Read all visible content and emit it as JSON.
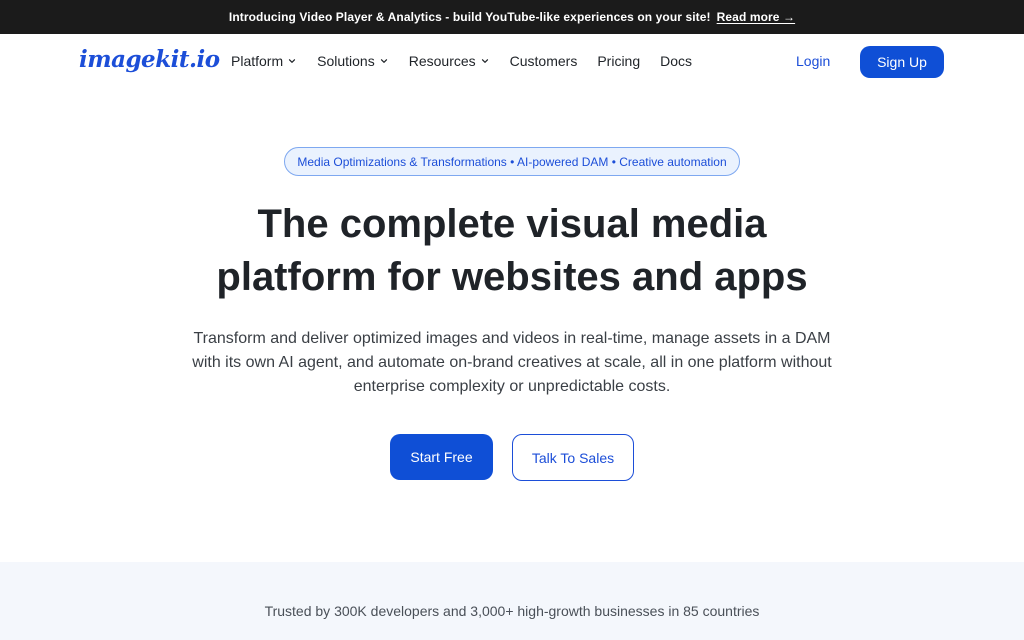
{
  "announcement": {
    "text": "Introducing Video Player & Analytics - build YouTube-like experiences on your site!",
    "link_label": "Read more →"
  },
  "nav": {
    "logo": "imagekit.io",
    "items": [
      {
        "label": "Platform",
        "has_dropdown": true,
        "icon": "chevron-down-icon"
      },
      {
        "label": "Solutions",
        "has_dropdown": true,
        "icon": "chevron-down-icon"
      },
      {
        "label": "Resources",
        "has_dropdown": true,
        "icon": "chevron-down-icon"
      },
      {
        "label": "Customers",
        "has_dropdown": false
      },
      {
        "label": "Pricing",
        "has_dropdown": false
      },
      {
        "label": "Docs",
        "has_dropdown": false
      }
    ],
    "login_label": "Login",
    "signup_label": "Sign Up"
  },
  "hero": {
    "pill": "Media Optimizations & Transformations • AI-powered DAM • Creative automation",
    "headline_line1": "The complete visual media",
    "headline_line2": "platform for websites and apps",
    "subtext_line1": "Transform and deliver optimized images and videos in real-time, manage assets in a DAM",
    "subtext_line2": "with its own AI agent, and automate on-brand creatives at scale, all in one platform without",
    "subtext_line3": "enterprise complexity or unpredictable costs.",
    "primary_cta": "Start Free",
    "secondary_cta": "Talk To Sales"
  },
  "trusted": {
    "text": "Trusted by 300K developers and 3,000+ high-growth businesses in 85 countries"
  },
  "colors": {
    "brand_blue": "#0f4fd6",
    "link_blue": "#1c4ed8",
    "announcement_bg": "#1b1b1b",
    "pill_bg": "#eaf2fe",
    "band_bg": "#f4f7fc"
  }
}
